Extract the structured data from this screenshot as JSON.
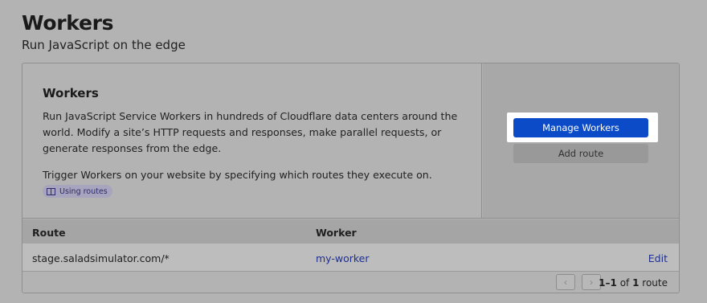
{
  "page": {
    "title": "Workers",
    "subtitle": "Run JavaScript on the edge"
  },
  "card": {
    "heading": "Workers",
    "description": "Run JavaScript Service Workers in hundreds of Cloudflare data centers around the world. Modify a site’s HTTP requests and responses, make parallel requests, or generate responses from the edge.",
    "trigger_text": "Trigger Workers on your website by specifying which routes they execute on.",
    "docs_link": "Using routes",
    "manage_button": "Manage Workers",
    "add_route_button": "Add route"
  },
  "table": {
    "columns": [
      "Route",
      "Worker"
    ],
    "rows": [
      {
        "route": "stage.saladsimulator.com/*",
        "worker": "my-worker",
        "action": "Edit"
      }
    ]
  },
  "pagination": {
    "prev": "‹",
    "next": "›",
    "range": "1–1",
    "of": "of",
    "total": "1",
    "unit": "route"
  },
  "colors": {
    "primary": "#0b4bc8",
    "link": "#1e2f8f"
  }
}
